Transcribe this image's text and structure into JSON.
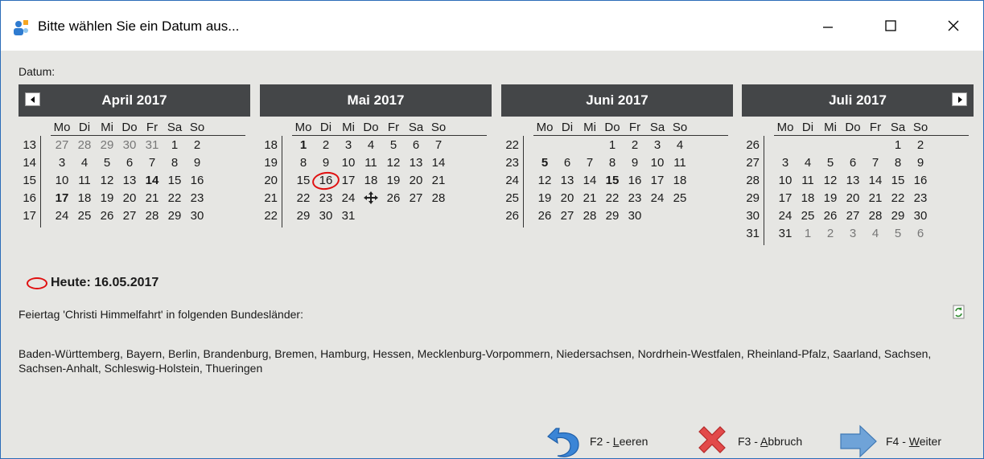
{
  "window": {
    "title": "Bitte wählen Sie ein Datum aus...",
    "controls": [
      "minimize",
      "maximize",
      "close"
    ]
  },
  "datum_label": "Datum:",
  "weekday_headers": [
    "Mo",
    "Di",
    "Mi",
    "Do",
    "Fr",
    "Sa",
    "So"
  ],
  "months": [
    {
      "title": "April 2017",
      "weeks": [
        {
          "wk": "13",
          "days": [
            {
              "d": "27",
              "gray": true
            },
            {
              "d": "28",
              "gray": true
            },
            {
              "d": "29",
              "gray": true
            },
            {
              "d": "30",
              "gray": true
            },
            {
              "d": "31",
              "gray": true
            },
            {
              "d": "1"
            },
            {
              "d": "2"
            }
          ]
        },
        {
          "wk": "14",
          "days": [
            {
              "d": "3"
            },
            {
              "d": "4"
            },
            {
              "d": "5"
            },
            {
              "d": "6"
            },
            {
              "d": "7"
            },
            {
              "d": "8"
            },
            {
              "d": "9"
            }
          ]
        },
        {
          "wk": "15",
          "days": [
            {
              "d": "10"
            },
            {
              "d": "11"
            },
            {
              "d": "12"
            },
            {
              "d": "13"
            },
            {
              "d": "14",
              "bold": true
            },
            {
              "d": "15"
            },
            {
              "d": "16"
            }
          ]
        },
        {
          "wk": "16",
          "days": [
            {
              "d": "17",
              "bold": true
            },
            {
              "d": "18"
            },
            {
              "d": "19"
            },
            {
              "d": "20"
            },
            {
              "d": "21"
            },
            {
              "d": "22"
            },
            {
              "d": "23"
            }
          ]
        },
        {
          "wk": "17",
          "days": [
            {
              "d": "24"
            },
            {
              "d": "25"
            },
            {
              "d": "26"
            },
            {
              "d": "27"
            },
            {
              "d": "28"
            },
            {
              "d": "29"
            },
            {
              "d": "30"
            }
          ]
        }
      ]
    },
    {
      "title": "Mai 2017",
      "weeks": [
        {
          "wk": "18",
          "days": [
            {
              "d": "1",
              "bold": true
            },
            {
              "d": "2"
            },
            {
              "d": "3"
            },
            {
              "d": "4"
            },
            {
              "d": "5"
            },
            {
              "d": "6"
            },
            {
              "d": "7"
            }
          ]
        },
        {
          "wk": "19",
          "days": [
            {
              "d": "8"
            },
            {
              "d": "9"
            },
            {
              "d": "10"
            },
            {
              "d": "11"
            },
            {
              "d": "12"
            },
            {
              "d": "13"
            },
            {
              "d": "14"
            }
          ]
        },
        {
          "wk": "20",
          "days": [
            {
              "d": "15"
            },
            {
              "d": "16",
              "today": true
            },
            {
              "d": "17"
            },
            {
              "d": "18"
            },
            {
              "d": "19"
            },
            {
              "d": "20"
            },
            {
              "d": "21"
            }
          ]
        },
        {
          "wk": "21",
          "days": [
            {
              "d": "22"
            },
            {
              "d": "23"
            },
            {
              "d": "24"
            },
            {
              "d": "25",
              "cursor": true
            },
            {
              "d": "26"
            },
            {
              "d": "27"
            },
            {
              "d": "28"
            }
          ]
        },
        {
          "wk": "22",
          "days": [
            {
              "d": "29"
            },
            {
              "d": "30"
            },
            {
              "d": "31"
            }
          ]
        }
      ]
    },
    {
      "title": "Juni 2017",
      "weeks": [
        {
          "wk": "22",
          "days": [
            {
              "d": ""
            },
            {
              "d": ""
            },
            {
              "d": ""
            },
            {
              "d": "1"
            },
            {
              "d": "2"
            },
            {
              "d": "3"
            },
            {
              "d": "4"
            }
          ]
        },
        {
          "wk": "23",
          "days": [
            {
              "d": "5",
              "bold": true
            },
            {
              "d": "6"
            },
            {
              "d": "7"
            },
            {
              "d": "8"
            },
            {
              "d": "9"
            },
            {
              "d": "10"
            },
            {
              "d": "11"
            }
          ]
        },
        {
          "wk": "24",
          "days": [
            {
              "d": "12"
            },
            {
              "d": "13"
            },
            {
              "d": "14"
            },
            {
              "d": "15",
              "bold": true
            },
            {
              "d": "16"
            },
            {
              "d": "17"
            },
            {
              "d": "18"
            }
          ]
        },
        {
          "wk": "25",
          "days": [
            {
              "d": "19"
            },
            {
              "d": "20"
            },
            {
              "d": "21"
            },
            {
              "d": "22"
            },
            {
              "d": "23"
            },
            {
              "d": "24"
            },
            {
              "d": "25"
            }
          ]
        },
        {
          "wk": "26",
          "days": [
            {
              "d": "26"
            },
            {
              "d": "27"
            },
            {
              "d": "28"
            },
            {
              "d": "29"
            },
            {
              "d": "30"
            }
          ]
        }
      ]
    },
    {
      "title": "Juli 2017",
      "weeks": [
        {
          "wk": "26",
          "days": [
            {
              "d": ""
            },
            {
              "d": ""
            },
            {
              "d": ""
            },
            {
              "d": ""
            },
            {
              "d": ""
            },
            {
              "d": "1"
            },
            {
              "d": "2"
            }
          ]
        },
        {
          "wk": "27",
          "days": [
            {
              "d": "3"
            },
            {
              "d": "4"
            },
            {
              "d": "5"
            },
            {
              "d": "6"
            },
            {
              "d": "7"
            },
            {
              "d": "8"
            },
            {
              "d": "9"
            }
          ]
        },
        {
          "wk": "28",
          "days": [
            {
              "d": "10"
            },
            {
              "d": "11"
            },
            {
              "d": "12"
            },
            {
              "d": "13"
            },
            {
              "d": "14"
            },
            {
              "d": "15"
            },
            {
              "d": "16"
            }
          ]
        },
        {
          "wk": "29",
          "days": [
            {
              "d": "17"
            },
            {
              "d": "18"
            },
            {
              "d": "19"
            },
            {
              "d": "20"
            },
            {
              "d": "21"
            },
            {
              "d": "22"
            },
            {
              "d": "23"
            }
          ]
        },
        {
          "wk": "30",
          "days": [
            {
              "d": "24"
            },
            {
              "d": "25"
            },
            {
              "d": "26"
            },
            {
              "d": "27"
            },
            {
              "d": "28"
            },
            {
              "d": "29"
            },
            {
              "d": "30"
            }
          ]
        },
        {
          "wk": "31",
          "days": [
            {
              "d": "31"
            },
            {
              "d": "1",
              "gray": true
            },
            {
              "d": "2",
              "gray": true
            },
            {
              "d": "3",
              "gray": true
            },
            {
              "d": "4",
              "gray": true
            },
            {
              "d": "5",
              "gray": true
            },
            {
              "d": "6",
              "gray": true
            }
          ]
        }
      ]
    }
  ],
  "today_text": "Heute: 16.05.2017",
  "holiday_text": "Feiertag 'Christi Himmelfahrt' in folgenden Bundesländer:",
  "states_text": "Baden-Württemberg, Bayern, Berlin, Brandenburg, Bremen, Hamburg, Hessen, Mecklenburg-Vorpommern, Niedersachsen, Nordrhein-Westfalen, Rheinland-Pfalz, Saarland, Sachsen, Sachsen-Anhalt, Schleswig-Holstein, Thueringen",
  "buttons": {
    "clear": {
      "prefix": "F2 - ",
      "accel": "L",
      "rest": "eeren"
    },
    "cancel": {
      "prefix": "F3 - ",
      "accel": "A",
      "rest": "bbruch"
    },
    "next": {
      "prefix": "F4 - ",
      "accel": "W",
      "rest": "eiter"
    }
  },
  "colors": {
    "header_bg": "#444648",
    "today_marker": "#e01010",
    "client_bg": "#e6e6e3"
  }
}
